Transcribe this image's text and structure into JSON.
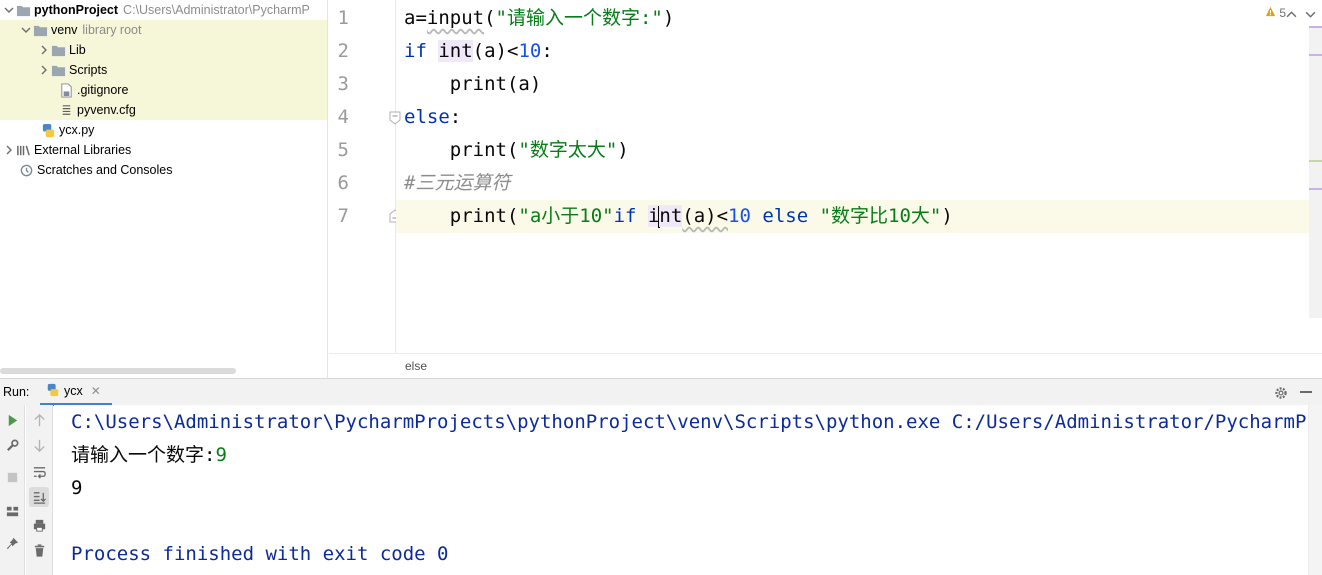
{
  "project": {
    "root_name": "pythonProject",
    "root_path": "C:\\Users\\Administrator\\PycharmP",
    "items": [
      {
        "label": "venv",
        "suffix": "library root"
      },
      {
        "label": "Lib"
      },
      {
        "label": "Scripts"
      },
      {
        "label": ".gitignore"
      },
      {
        "label": "pyvenv.cfg"
      },
      {
        "label": "ycx.py"
      },
      {
        "label": "External Libraries"
      },
      {
        "label": "Scratches and Consoles"
      }
    ]
  },
  "editor": {
    "line_numbers": [
      "1",
      "2",
      "3",
      "4",
      "5",
      "6",
      "7"
    ],
    "lines": {
      "l1": {
        "a1": "a=",
        "a2": "input",
        "a3": "(",
        "a4": "\"请输入一个数字:\"",
        "a5": ")"
      },
      "l2": {
        "a1": "if",
        "a2": " ",
        "a3": "int",
        "a4": "(a)<",
        "a5": "10",
        "a6": ":"
      },
      "l3": {
        "a1": "    print(a)"
      },
      "l4": {
        "a1": "else",
        "a2": ":"
      },
      "l5": {
        "a1": "    print(",
        "a2": "\"数字太大\"",
        "a3": ")"
      },
      "l6": {
        "a1": "#三元运算符"
      },
      "l7": {
        "a1": "    print(",
        "a2": "\"a小于10\"",
        "a3": "if",
        "a4": " ",
        "a5": "i",
        "a6": "nt",
        "a7": "(a)<",
        "a8": "10",
        "a9": " ",
        "a10": "else",
        "a11": " ",
        "a12": "\"数字比10大\"",
        "a13": ")"
      }
    },
    "inspection_count": "5",
    "breadcrumb": "else",
    "colors": {
      "keyword": "#0033b3",
      "string": "#067d17",
      "number": "#1750eb",
      "comment": "#8c8c8c",
      "current_line": "#fbfae9"
    }
  },
  "run": {
    "label": "Run:",
    "tab_label": "ycx",
    "console": {
      "command": "C:\\Users\\Administrator\\PycharmProjects\\pythonProject\\venv\\Scripts\\python.exe C:/Users/Administrator/PycharmProjects/pythonProject/ycx.py",
      "prompt": "请输入一个数字:",
      "input_value": "9",
      "output": "9",
      "exit_message": "Process finished with exit code 0"
    }
  }
}
